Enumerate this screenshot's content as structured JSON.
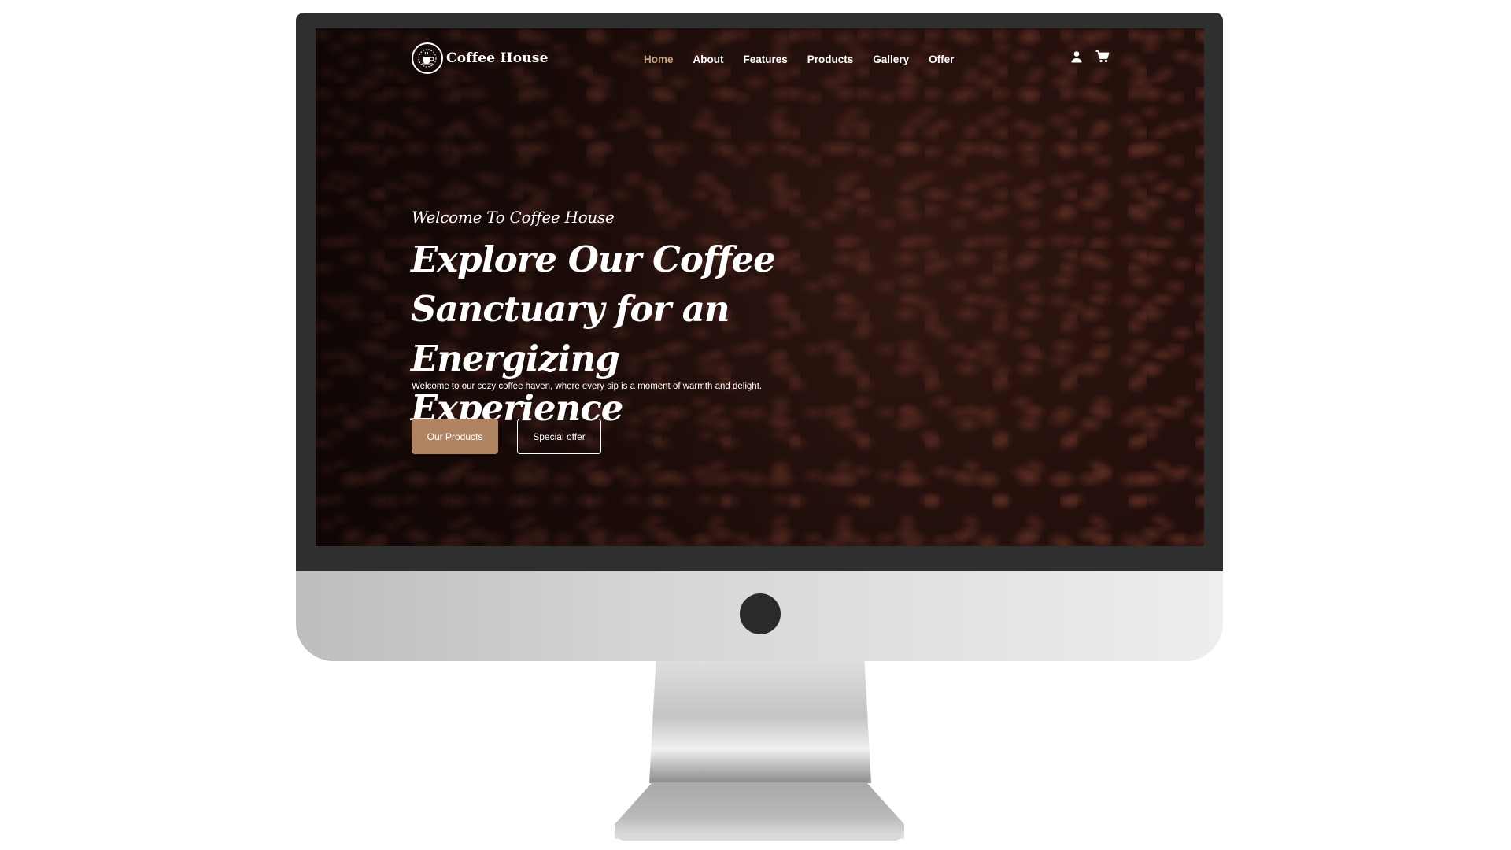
{
  "site": {
    "brand": "Coffee House",
    "logo_icon": "coffee-cup-badge-icon"
  },
  "nav": {
    "items": [
      {
        "label": "Home",
        "active": true
      },
      {
        "label": "About",
        "active": false
      },
      {
        "label": "Features",
        "active": false
      },
      {
        "label": "Products",
        "active": false
      },
      {
        "label": "Gallery",
        "active": false
      },
      {
        "label": "Offer",
        "active": false
      }
    ],
    "icons": [
      "user-icon",
      "cart-icon"
    ]
  },
  "hero": {
    "eyebrow": "Welcome To Coffee House",
    "title_lines": [
      "Explore Our Coffee",
      "Sanctuary for an",
      "Energizing Experience"
    ],
    "subtitle": "Welcome to our cozy coffee haven, where every sip is a moment of warmth and delight.",
    "primary_button": "Our Products",
    "secondary_button": "Special offer"
  },
  "colors": {
    "accent": "#c7a283",
    "button": "#b08463",
    "background": "#1b0c0a",
    "text": "#ffffff"
  }
}
